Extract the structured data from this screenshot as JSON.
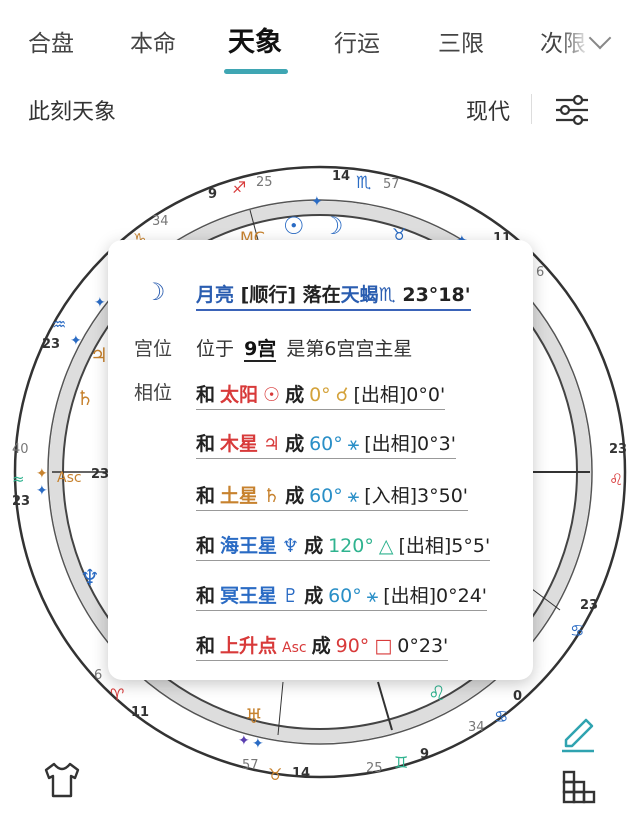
{
  "tabs": [
    {
      "label": "合盘"
    },
    {
      "label": "本命"
    },
    {
      "label": "天象"
    },
    {
      "label": "行运"
    },
    {
      "label": "三限"
    },
    {
      "label": "次限"
    }
  ],
  "active_tab": "天象",
  "subtitle": "此刻天象",
  "mode_button": "现代",
  "wheel": {
    "degree_labels": [
      "9",
      "25",
      "14",
      "57",
      "34",
      "11",
      "6",
      "23",
      "40",
      "23",
      "23",
      "23",
      "23",
      "6",
      "11",
      "57",
      "14",
      "25",
      "9",
      "34",
      "0"
    ],
    "asc_label": "Asc",
    "mc_label": "MC"
  },
  "popup": {
    "headline": {
      "planet": "月亮",
      "motion": "[顺行]",
      "in": "落在",
      "sign": "天蝎",
      "sign_glyph": "♏",
      "degree": "23°18'"
    },
    "house_label": "宫位",
    "house_text_pre": "位于",
    "house_num": "9宫",
    "house_text_post": "是第6宫宫主星",
    "aspect_label": "相位",
    "aspects": [
      {
        "prefix": "和",
        "planet": "太阳",
        "glyph": "☉",
        "cheng": "成",
        "angle": "0°",
        "angle_glyph": "☌",
        "info": "[出相]0°0'",
        "planet_color": "#d83a3a",
        "angle_color": "#d4a23a"
      },
      {
        "prefix": "和",
        "planet": "木星",
        "glyph": "♃",
        "cheng": "成",
        "angle": "60°",
        "angle_glyph": "⚹",
        "info": "[出相]0°3'",
        "planet_color": "#d83a3a",
        "angle_color": "#2a8fc7"
      },
      {
        "prefix": "和",
        "planet": "土星",
        "glyph": "♄",
        "cheng": "成",
        "angle": "60°",
        "angle_glyph": "⚹",
        "info": "[入相]3°50'",
        "planet_color": "#c7822e",
        "angle_color": "#2a8fc7"
      },
      {
        "prefix": "和",
        "planet": "海王星",
        "glyph": "♆",
        "cheng": "成",
        "angle": "120°",
        "angle_glyph": "△",
        "info": "[出相]5°5'",
        "planet_color": "#2a6bc4",
        "angle_color": "#2fb38f"
      },
      {
        "prefix": "和",
        "planet": "冥王星",
        "glyph": "♇",
        "cheng": "成",
        "angle": "60°",
        "angle_glyph": "⚹",
        "info": "[出相]0°24'",
        "planet_color": "#2a6bc4",
        "angle_color": "#2a8fc7"
      },
      {
        "prefix": "和",
        "planet": "上升点",
        "glyph": "Asc",
        "cheng": "成",
        "angle": "90°",
        "angle_glyph": "□",
        "info": "0°23'",
        "planet_color": "#d83a3a",
        "angle_color": "#d83a3a"
      }
    ]
  }
}
